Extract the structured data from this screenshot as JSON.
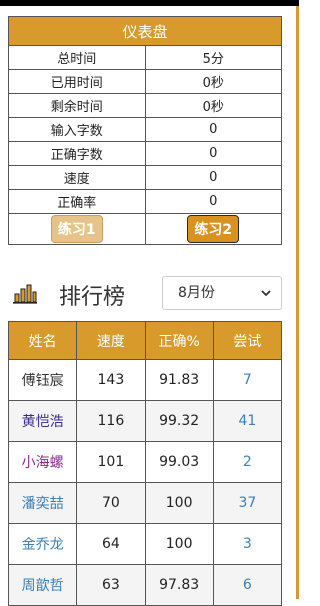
{
  "dashboard": {
    "title": "仪表盘",
    "rows": [
      {
        "label": "总时间",
        "value": "5分"
      },
      {
        "label": "已用时间",
        "value": "0秒"
      },
      {
        "label": "剩余时间",
        "value": "0秒"
      },
      {
        "label": "输入字数",
        "value": "0"
      },
      {
        "label": "正确字数",
        "value": "0"
      },
      {
        "label": "速度",
        "value": "0"
      },
      {
        "label": "正确率",
        "value": "0"
      }
    ],
    "buttons": [
      "练习1",
      "练习2"
    ]
  },
  "leaderboard": {
    "title": "排行榜",
    "month": "8月份",
    "headers": [
      "姓名",
      "速度",
      "正确%",
      "尝试"
    ],
    "rows": [
      {
        "name": "傅钰宸",
        "speed": "143",
        "accuracy": "91.83",
        "attempts": "7",
        "name_color": "#333333"
      },
      {
        "name": "黄恺浩",
        "speed": "116",
        "accuracy": "99.32",
        "attempts": "41",
        "name_color": "#3b2a8c"
      },
      {
        "name": "小海螺",
        "speed": "101",
        "accuracy": "99.03",
        "attempts": "2",
        "name_color": "#8a2a8c"
      },
      {
        "name": "潘奕喆",
        "speed": "70",
        "accuracy": "100",
        "attempts": "37",
        "name_color": "#3d7fb8"
      },
      {
        "name": "金乔龙",
        "speed": "64",
        "accuracy": "100",
        "attempts": "3",
        "name_color": "#3d7fb8"
      },
      {
        "name": "周歆哲",
        "speed": "63",
        "accuracy": "97.83",
        "attempts": "6",
        "name_color": "#3d7fb8"
      }
    ]
  },
  "colors": {
    "accent": "#d79a2b",
    "link": "#3d7fb8"
  },
  "icons": {
    "rank": "bar-chart-icon",
    "select": "chevron-down-icon"
  }
}
